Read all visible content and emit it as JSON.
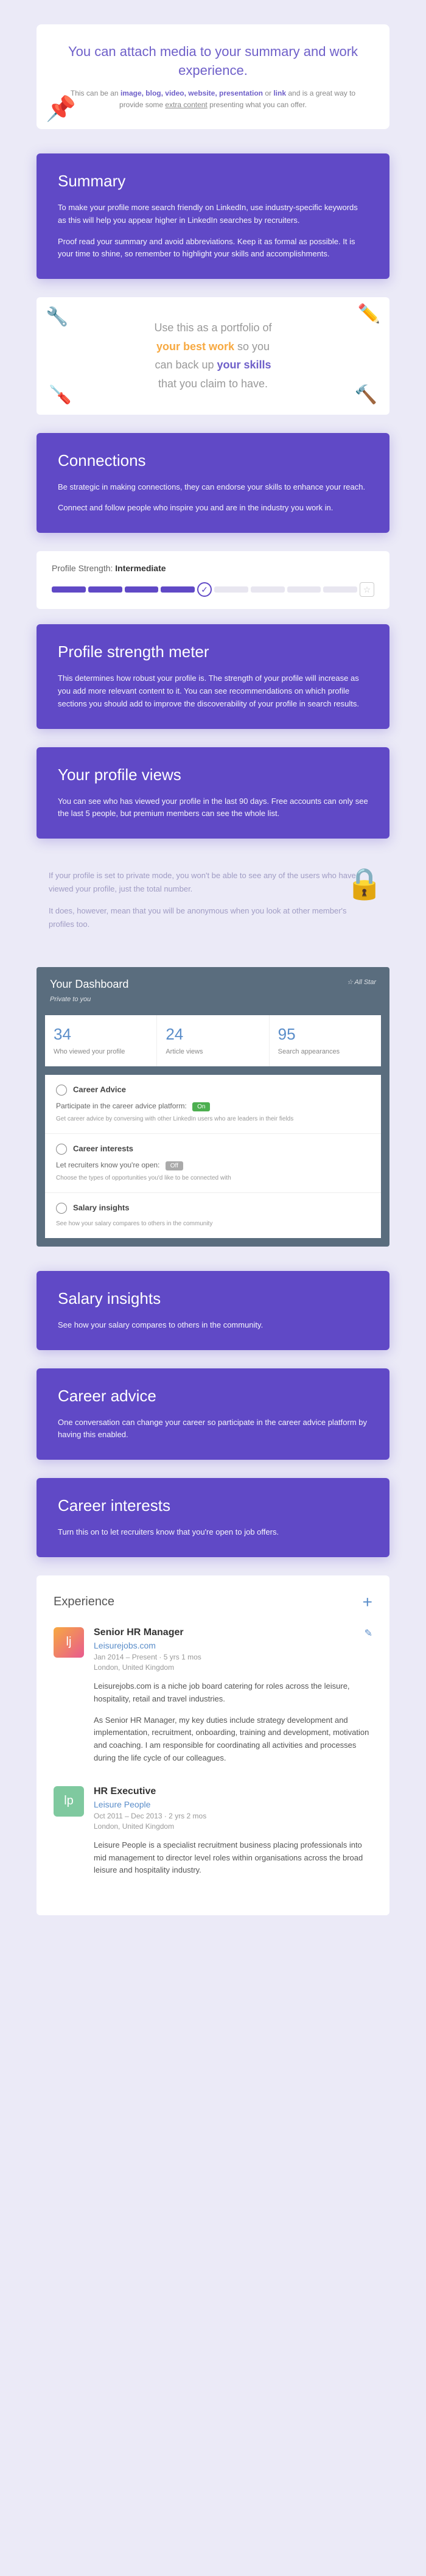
{
  "media": {
    "heading": "You can attach media to your summary and work experience.",
    "body_pre": "This can be an ",
    "types": "image, blog, video, website, presentation",
    "body_mid": " or ",
    "link": "link",
    "body_post": " and is a great way to provide some ",
    "extra": "extra content",
    "body_end": " presenting what you can offer."
  },
  "summary": {
    "title": "Summary",
    "p1": "To make your profile more search friendly on LinkedIn, use industry-specific keywords as this will help you appear higher in LinkedIn searches by recruiters.",
    "p2": "Proof read your summary and avoid abbreviations. Keep it as formal as possible. It is your time to shine, so remember to highlight your skills and accomplishments."
  },
  "portfolio": {
    "l1": "Use this as a portfolio of",
    "l2": "your best work",
    "l3": " so you",
    "l4": "can back up ",
    "l5": "your skills",
    "l6": "that you claim to have."
  },
  "connections": {
    "title": "Connections",
    "p1": "Be strategic in making connections, they can endorse your skills to enhance your reach.",
    "p2": "Connect and follow people who inspire you and are in the industry you work in."
  },
  "strength": {
    "label": "Profile Strength: ",
    "value": "Intermediate"
  },
  "meter": {
    "title": "Profile strength meter",
    "p1": "This determines how robust your profile is. The strength of your profile will increase as you add more relevant content to it. You can see recommendations on which profile sections you should add to improve the discoverability of your profile in search results."
  },
  "views": {
    "title": "Your profile views",
    "p1": "You can see who has viewed your profile in the last 90 days. Free accounts can only see the last 5 people, but premium members can see the whole list."
  },
  "priv": {
    "p1": "If your profile is set to private mode, you won't be able to see any of the users who have viewed your profile, just the total number.",
    "p2": "It does, however, mean that you will be anonymous when you look at other member's profiles too."
  },
  "dashboard": {
    "title": "Your Dashboard",
    "subtitle": "Private to you",
    "star": "☆ All Star",
    "stats": [
      {
        "num": "34",
        "lbl": "Who viewed your profile"
      },
      {
        "num": "24",
        "lbl": "Article views"
      },
      {
        "num": "95",
        "lbl": "Search appearances"
      }
    ],
    "items": [
      {
        "ttl": "Career Advice",
        "sub": "Participate in the career advice platform:",
        "toggle": "On",
        "desc": "Get career advice by conversing with other LinkedIn users who are leaders in their fields"
      },
      {
        "ttl": "Career interests",
        "sub": "Let recruiters know you're open:",
        "toggle": "Off",
        "desc": "Choose the types of opportunities you'd like to be connected with"
      },
      {
        "ttl": "Salary insights",
        "sub": "",
        "toggle": "",
        "desc": "See how your salary compares to others in the community"
      }
    ]
  },
  "salary": {
    "title": "Salary insights",
    "p1": "See how your salary compares to others in the community."
  },
  "advice": {
    "title": "Career advice",
    "p1": "One conversation can change your career so participate in the career advice platform by having this enabled."
  },
  "interests": {
    "title": "Career interests",
    "p1": "Turn this on to let recruiters know that you're open to job offers."
  },
  "experience": {
    "title": "Experience",
    "jobs": [
      {
        "title": "Senior HR Manager",
        "company": "Leisurejobs.com",
        "dates": "Jan 2014 – Present · 5 yrs 1 mos",
        "loc": "London, United Kingdom",
        "d1": "Leisurejobs.com is a niche job board catering for roles across the leisure, hospitality, retail and travel industries.",
        "d2": "As Senior HR Manager, my key duties include strategy development and implementation, recruitment, onboarding, training and development, motivation and coaching. I am responsible for coordinating all activities and processes during the life cycle of our colleagues.",
        "logo": "lj"
      },
      {
        "title": "HR Executive",
        "company": "Leisure People",
        "dates": "Oct 2011 – Dec 2013 · 2 yrs 2 mos",
        "loc": "London, United Kingdom",
        "d1": "Leisure People is a specialist recruitment business placing professionals into mid management to director level roles within organisations across the broad leisure and hospitality industry.",
        "d2": "",
        "logo": "lp"
      }
    ]
  }
}
